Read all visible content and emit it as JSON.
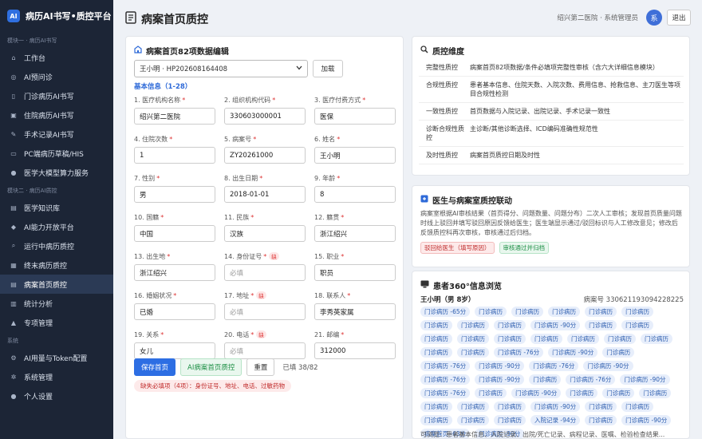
{
  "brand": {
    "logo": "AI",
    "title": "病历AI书写•质控平台"
  },
  "sidebar": {
    "sections": [
      {
        "label": "模块一 · 病历AI书写",
        "items": [
          {
            "label": "工作台",
            "icon": "home-icon"
          },
          {
            "label": "AI预问诊",
            "icon": "ai-icon"
          },
          {
            "label": "门诊病历AI书写",
            "icon": "door-icon"
          },
          {
            "label": "住院病历AI书写",
            "icon": "hospital-icon"
          },
          {
            "label": "手术记录AI书写",
            "icon": "scalpel-icon"
          },
          {
            "label": "PC端病历草稿/HIS",
            "icon": "monitor-icon"
          },
          {
            "label": "医学大模型算力服务",
            "icon": "brain-icon"
          }
        ]
      },
      {
        "label": "模块二 · 病历AI质控",
        "items": [
          {
            "label": "医学知识库",
            "icon": "book-icon"
          },
          {
            "label": "AI能力开放平台",
            "icon": "robot-icon"
          },
          {
            "label": "运行中病历质控",
            "icon": "search-icon"
          },
          {
            "label": "终末病历质控",
            "icon": "clipboard-icon"
          },
          {
            "label": "病案首页质控",
            "icon": "document-icon",
            "active": true
          },
          {
            "label": "统计分析",
            "icon": "chart-icon"
          },
          {
            "label": "专项管理",
            "icon": "warning-icon"
          }
        ]
      },
      {
        "label": "系统",
        "items": [
          {
            "label": "AI用量与Token配置",
            "icon": "gear-icon"
          },
          {
            "label": "系统管理",
            "icon": "settings-icon"
          },
          {
            "label": "个人设置",
            "icon": "user-icon"
          }
        ]
      }
    ]
  },
  "header": {
    "title": "病案首页质控",
    "user": "绍兴第二医院 · 系统管理员",
    "avatar": "系",
    "logout": "退出"
  },
  "edit": {
    "title": "病案首页82项数据编辑",
    "patient_select": "王小明 · HP202608164408",
    "load_label": "加载",
    "basic_label": "基本信息（1-28）",
    "fields": [
      {
        "label": "1. 医疗机构名称",
        "value": "绍兴第二医院",
        "required": true
      },
      {
        "label": "2. 组织机构代码",
        "value": "330603000001",
        "required": true
      },
      {
        "label": "3. 医疗付费方式",
        "value": "医保",
        "required": true
      },
      {
        "label": "4. 住院次数",
        "value": "1",
        "required": true
      },
      {
        "label": "5. 病案号",
        "value": "ZY20261000",
        "required": true
      },
      {
        "label": "6. 姓名",
        "value": "王小明",
        "required": true
      },
      {
        "label": "7. 性别",
        "value": "男",
        "required": true
      },
      {
        "label": "8. 出生日期",
        "value": "2018-01-01",
        "required": true
      },
      {
        "label": "9. 年龄",
        "value": "8",
        "required": true
      },
      {
        "label": "10. 国籍",
        "value": "中国",
        "required": true
      },
      {
        "label": "11. 民族",
        "value": "汉族",
        "required": true
      },
      {
        "label": "12. 籍贯",
        "value": "浙江绍兴",
        "required": true
      },
      {
        "label": "13. 出生地",
        "value": "浙江绍兴",
        "required": true
      },
      {
        "label": "14. 身份证号",
        "placeholder": "必填",
        "required": true,
        "badge": "缺"
      },
      {
        "label": "15. 职业",
        "value": "职员",
        "required": true
      },
      {
        "label": "16. 婚姻状况",
        "value": "已婚",
        "required": true
      },
      {
        "label": "17. 地址",
        "placeholder": "必填",
        "required": true,
        "badge": "缺"
      },
      {
        "label": "18. 联系人",
        "value": "李秀英家属",
        "required": true
      },
      {
        "label": "19. 关系",
        "value": "女儿",
        "required": true
      },
      {
        "label": "20. 电话",
        "placeholder": "必填",
        "required": true,
        "badge": "缺"
      },
      {
        "label": "21. 邮编",
        "value": "312000",
        "required": true
      }
    ],
    "save_label": "保存首页",
    "ai_label": "AI病案首页质控",
    "reset_label": "重置",
    "filled": "已填 38/82",
    "missing": "缺失必填项（4项）：身份证号、地址、电话、过敏药物"
  },
  "dims": {
    "title": "质控维度",
    "rows": [
      {
        "key": "完整性质控",
        "value": "病案首页82项数据/条件必填项完整性审核（含六大详细信息模块）"
      },
      {
        "key": "合规性质控",
        "value": "患者基本信息、住院天数、入院次数、费用信息、抢救信息、主刀医生等项目合规性检测"
      },
      {
        "key": "一致性质控",
        "value": "首页数据与入院记录、出院记录、手术记录一致性"
      },
      {
        "key": "诊断合规性质控",
        "value": "主诊断/其他诊断选择、ICD编码准确性规范性"
      },
      {
        "key": "及时性质控",
        "value": "病案首页质控日期及时性"
      }
    ]
  },
  "link": {
    "title": "医生与病案室质控联动",
    "text": "病案室根据AI审核结果（首页得分、问题数量、问题分布）二次人工审核；发现首页质量问题时线上驳回并填写驳回原因反馈给医生；医生端显示通过/驳回标识与人工修改意见；修改后反馈质控科再次审核，审核通过后归档。",
    "reject_label": "驳回给医生（填写原因）",
    "approve_label": "审核通过并归档"
  },
  "p360": {
    "title": "患者360°信息浏览",
    "patient": "王小明（男 8岁）",
    "record_no": "病案号 330621193094228225",
    "chips": [
      "门诊病历 -65分",
      "门诊病历",
      "门诊病历",
      "门诊病历",
      "门诊病历",
      "门诊病历",
      "门诊病历",
      "门诊病历",
      "门诊病历",
      "门诊病历 -90分",
      "门诊病历",
      "门诊病历",
      "门诊病历",
      "门诊病历",
      "门诊病历",
      "门诊病历",
      "门诊病历",
      "门诊病历",
      "门诊病历",
      "门诊病历",
      "门诊病历",
      "门诊病历 -76分",
      "门诊病历 -90分",
      "门诊病历",
      "门诊病历 -76分",
      "门诊病历 -90分",
      "门诊病历 -76分",
      "门诊病历 -90分",
      "门诊病历 -76分",
      "门诊病历 -90分",
      "门诊病历",
      "门诊病历 -76分",
      "门诊病历 -90分",
      "门诊病历 -76分",
      "门诊病历",
      "门诊病历 -90分",
      "门诊病历",
      "门诊病历",
      "门诊病历",
      "门诊病历",
      "门诊病历",
      "门诊病历",
      "门诊病历 -90分",
      "门诊病历",
      "门诊病历",
      "门诊病历",
      "门诊病历",
      "门诊病历",
      "入院记录 -94分",
      "门诊病历",
      "门诊病历 -90分",
      "病案首页 -63分",
      "门诊病历 -90分"
    ],
    "more": "可浏览：患者基本信息、入院记录、出院/死亡记录、病程记录、医嘱、检验检查结果..."
  }
}
